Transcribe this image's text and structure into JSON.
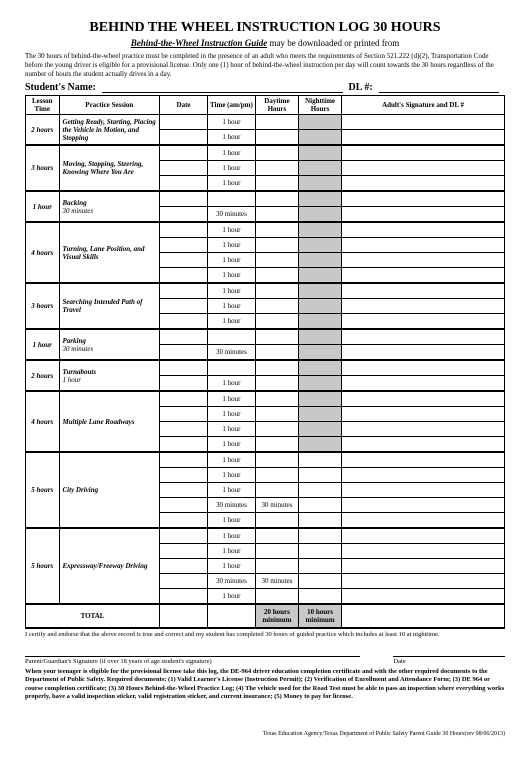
{
  "title": "BEHIND THE WHEEL INSTRUCTION LOG 30 HOURS",
  "subtitle_u": "Behind-the-Wheel Instruction Guide",
  "subtitle_rest": " may be downloaded or printed from",
  "intro": "The 30 hours of behind-the-wheel practice must be completed in the presence of an adult who meets the requirements of Section 521.222 (d)(2), Transportation Code before the young driver is eligible for a provisional license. Only one (1) hour of behind-the-wheel instruction per day will count towards the 30 hours regardless of the number of hours the student actually drives in a day.",
  "name_label": "Student's Name:",
  "dl_label": "DL #:",
  "headers": {
    "lesson": "Lesson Time",
    "session": "Practice Session",
    "date": "Date",
    "time": "Time (am/pm)",
    "day": "Daytime Hours",
    "night": "Nighttime Hours",
    "sig": "Adult's Signature and DL #"
  },
  "h1": "1 hour",
  "m30": "30 minutes",
  "lessons": {
    "l1_time": "2 hours",
    "l1_name": "Getting Ready, Starting, Placing the Vehicle in Motion, and Stopping",
    "l2_time": "3 hours",
    "l2_name": "Moving, Stopping, Steering, Knowing Where You Are",
    "l3_time": "1 hour",
    "l3_name": "Backing",
    "l3_sub": "30 minutes",
    "l4_time": "4 hours",
    "l4_name": "Turning, Lane Position, and Visual Skills",
    "l5_time": "3 hours",
    "l5_name": "Searching Intended Path of Travel",
    "l6_time": "1 hour",
    "l6_name": "Parking",
    "l6_sub": "30 minutes",
    "l7_time": "2 hours",
    "l7_name": "Turnabouts",
    "l7_sub": "1 hour",
    "l8_time": "4 hours",
    "l8_name": "Multiple Lane Roadways",
    "l9_time": "5 hours",
    "l9_name": "City Driving",
    "l10_time": "5 hours",
    "l10_name": "Expressway/Freeway Driving"
  },
  "total_label": "TOTAL",
  "total_day": "20 hours minimum",
  "total_night": "10 hours minimum",
  "cert": "I certify and endorse that the above record is true and correct and my student has completed 30 hours of guided practice which includes at least 10 at nighttime.",
  "sig_label": "Parent/Guardian's Signature (if over 18 years of age student's signature)",
  "date_label": "Date",
  "bottom": "When your teenager is eligible for the provisional license take this log, the DE-964 driver education completion certificate and with the other required documents to the Department of Public Safety. Required documents: (1) Valid Learner's License (Instruction Permit); (2) Verification of Enrollment and Attendance Form; (3) DE 964 or course completion certificate; (3) 30 Hours Behind-the-Wheel Practice Log; (4) The vehicle used for the Road Test must be able to pass an inspection where everything works properly, have a valid inspection sticker, valid registration sticker, and current insurance; (5) Money to pay for license.",
  "footer": "Texas Education Agency/Texas Department of Public Safety   Parent Guide 30 Hours(rev 08/06/2013)"
}
